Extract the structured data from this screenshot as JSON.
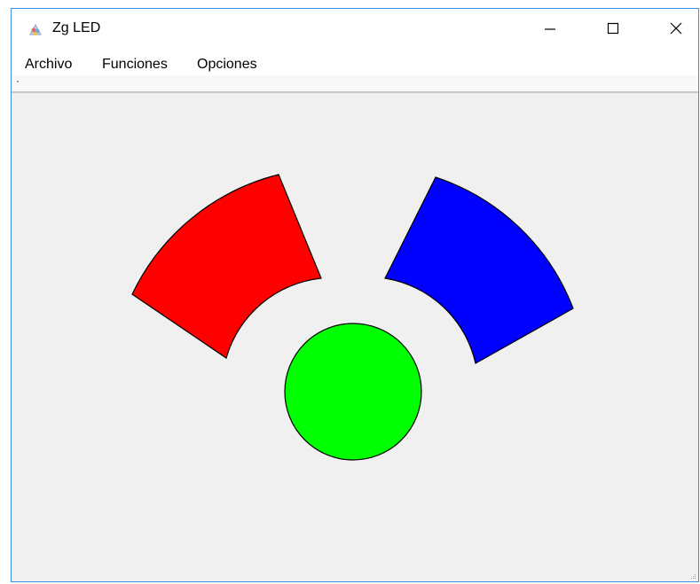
{
  "window": {
    "title": "Zg LED",
    "icon": "app-icon"
  },
  "controls": {
    "minimize_icon": "minimize-icon",
    "maximize_icon": "maximize-icon",
    "close_icon": "close-icon"
  },
  "menu": {
    "items": [
      {
        "label": "Archivo"
      },
      {
        "label": "Funciones"
      },
      {
        "label": "Opciones"
      }
    ]
  },
  "leds": {
    "red": {
      "color": "#ff0000"
    },
    "green": {
      "color": "#00ff00"
    },
    "blue": {
      "color": "#0000ff"
    }
  }
}
